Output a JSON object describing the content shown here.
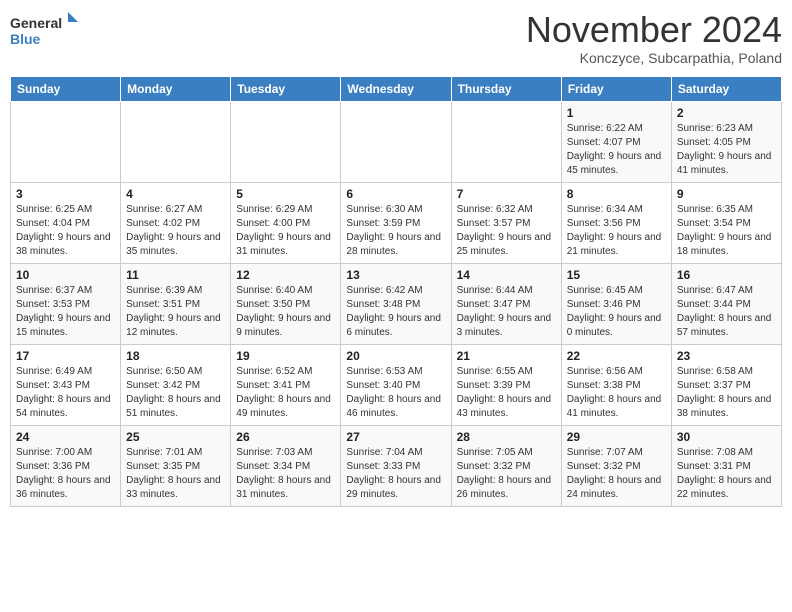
{
  "header": {
    "logo_general": "General",
    "logo_blue": "Blue",
    "month_title": "November 2024",
    "location": "Konczyce, Subcarpathia, Poland"
  },
  "calendar": {
    "days_of_week": [
      "Sunday",
      "Monday",
      "Tuesday",
      "Wednesday",
      "Thursday",
      "Friday",
      "Saturday"
    ],
    "weeks": [
      [
        {
          "day": "",
          "info": ""
        },
        {
          "day": "",
          "info": ""
        },
        {
          "day": "",
          "info": ""
        },
        {
          "day": "",
          "info": ""
        },
        {
          "day": "",
          "info": ""
        },
        {
          "day": "1",
          "info": "Sunrise: 6:22 AM\nSunset: 4:07 PM\nDaylight: 9 hours and 45 minutes."
        },
        {
          "day": "2",
          "info": "Sunrise: 6:23 AM\nSunset: 4:05 PM\nDaylight: 9 hours and 41 minutes."
        }
      ],
      [
        {
          "day": "3",
          "info": "Sunrise: 6:25 AM\nSunset: 4:04 PM\nDaylight: 9 hours and 38 minutes."
        },
        {
          "day": "4",
          "info": "Sunrise: 6:27 AM\nSunset: 4:02 PM\nDaylight: 9 hours and 35 minutes."
        },
        {
          "day": "5",
          "info": "Sunrise: 6:29 AM\nSunset: 4:00 PM\nDaylight: 9 hours and 31 minutes."
        },
        {
          "day": "6",
          "info": "Sunrise: 6:30 AM\nSunset: 3:59 PM\nDaylight: 9 hours and 28 minutes."
        },
        {
          "day": "7",
          "info": "Sunrise: 6:32 AM\nSunset: 3:57 PM\nDaylight: 9 hours and 25 minutes."
        },
        {
          "day": "8",
          "info": "Sunrise: 6:34 AM\nSunset: 3:56 PM\nDaylight: 9 hours and 21 minutes."
        },
        {
          "day": "9",
          "info": "Sunrise: 6:35 AM\nSunset: 3:54 PM\nDaylight: 9 hours and 18 minutes."
        }
      ],
      [
        {
          "day": "10",
          "info": "Sunrise: 6:37 AM\nSunset: 3:53 PM\nDaylight: 9 hours and 15 minutes."
        },
        {
          "day": "11",
          "info": "Sunrise: 6:39 AM\nSunset: 3:51 PM\nDaylight: 9 hours and 12 minutes."
        },
        {
          "day": "12",
          "info": "Sunrise: 6:40 AM\nSunset: 3:50 PM\nDaylight: 9 hours and 9 minutes."
        },
        {
          "day": "13",
          "info": "Sunrise: 6:42 AM\nSunset: 3:48 PM\nDaylight: 9 hours and 6 minutes."
        },
        {
          "day": "14",
          "info": "Sunrise: 6:44 AM\nSunset: 3:47 PM\nDaylight: 9 hours and 3 minutes."
        },
        {
          "day": "15",
          "info": "Sunrise: 6:45 AM\nSunset: 3:46 PM\nDaylight: 9 hours and 0 minutes."
        },
        {
          "day": "16",
          "info": "Sunrise: 6:47 AM\nSunset: 3:44 PM\nDaylight: 8 hours and 57 minutes."
        }
      ],
      [
        {
          "day": "17",
          "info": "Sunrise: 6:49 AM\nSunset: 3:43 PM\nDaylight: 8 hours and 54 minutes."
        },
        {
          "day": "18",
          "info": "Sunrise: 6:50 AM\nSunset: 3:42 PM\nDaylight: 8 hours and 51 minutes."
        },
        {
          "day": "19",
          "info": "Sunrise: 6:52 AM\nSunset: 3:41 PM\nDaylight: 8 hours and 49 minutes."
        },
        {
          "day": "20",
          "info": "Sunrise: 6:53 AM\nSunset: 3:40 PM\nDaylight: 8 hours and 46 minutes."
        },
        {
          "day": "21",
          "info": "Sunrise: 6:55 AM\nSunset: 3:39 PM\nDaylight: 8 hours and 43 minutes."
        },
        {
          "day": "22",
          "info": "Sunrise: 6:56 AM\nSunset: 3:38 PM\nDaylight: 8 hours and 41 minutes."
        },
        {
          "day": "23",
          "info": "Sunrise: 6:58 AM\nSunset: 3:37 PM\nDaylight: 8 hours and 38 minutes."
        }
      ],
      [
        {
          "day": "24",
          "info": "Sunrise: 7:00 AM\nSunset: 3:36 PM\nDaylight: 8 hours and 36 minutes."
        },
        {
          "day": "25",
          "info": "Sunrise: 7:01 AM\nSunset: 3:35 PM\nDaylight: 8 hours and 33 minutes."
        },
        {
          "day": "26",
          "info": "Sunrise: 7:03 AM\nSunset: 3:34 PM\nDaylight: 8 hours and 31 minutes."
        },
        {
          "day": "27",
          "info": "Sunrise: 7:04 AM\nSunset: 3:33 PM\nDaylight: 8 hours and 29 minutes."
        },
        {
          "day": "28",
          "info": "Sunrise: 7:05 AM\nSunset: 3:32 PM\nDaylight: 8 hours and 26 minutes."
        },
        {
          "day": "29",
          "info": "Sunrise: 7:07 AM\nSunset: 3:32 PM\nDaylight: 8 hours and 24 minutes."
        },
        {
          "day": "30",
          "info": "Sunrise: 7:08 AM\nSunset: 3:31 PM\nDaylight: 8 hours and 22 minutes."
        }
      ]
    ]
  }
}
